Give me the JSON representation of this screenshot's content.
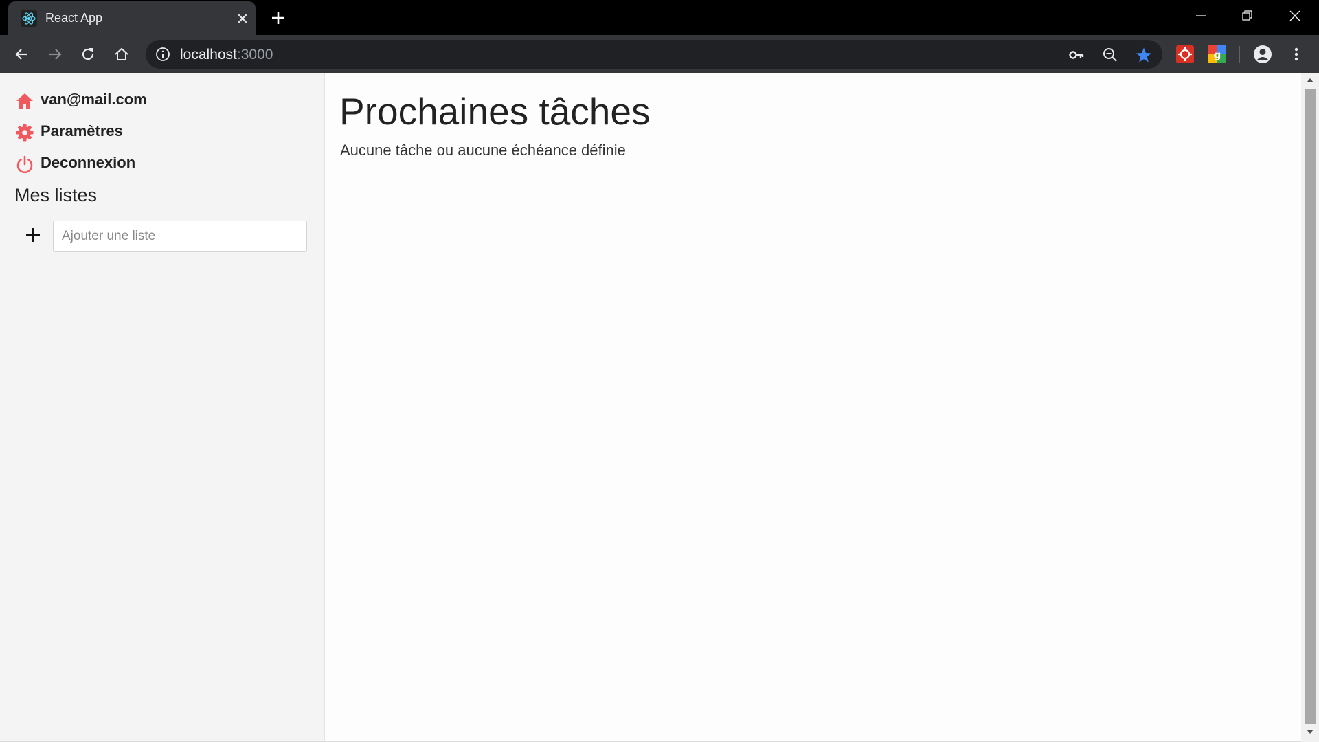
{
  "browser": {
    "tab_title": "React App",
    "url_host": "localhost",
    "url_port": ":3000"
  },
  "sidebar": {
    "items": [
      {
        "label": "van@mail.com",
        "icon": "home-icon"
      },
      {
        "label": "Paramètres",
        "icon": "gear-icon"
      },
      {
        "label": "Deconnexion",
        "icon": "power-icon"
      }
    ],
    "lists_heading": "Mes listes",
    "add_list_placeholder": "Ajouter une liste"
  },
  "main": {
    "title": "Prochaines tâches",
    "empty_message": "Aucune tâche ou aucune échéance définie"
  },
  "colors": {
    "accent": "#f0595d",
    "sidebar_bg": "#f4f4f4",
    "chrome_dark": "#35363a",
    "bookmark_star": "#4285f4"
  }
}
